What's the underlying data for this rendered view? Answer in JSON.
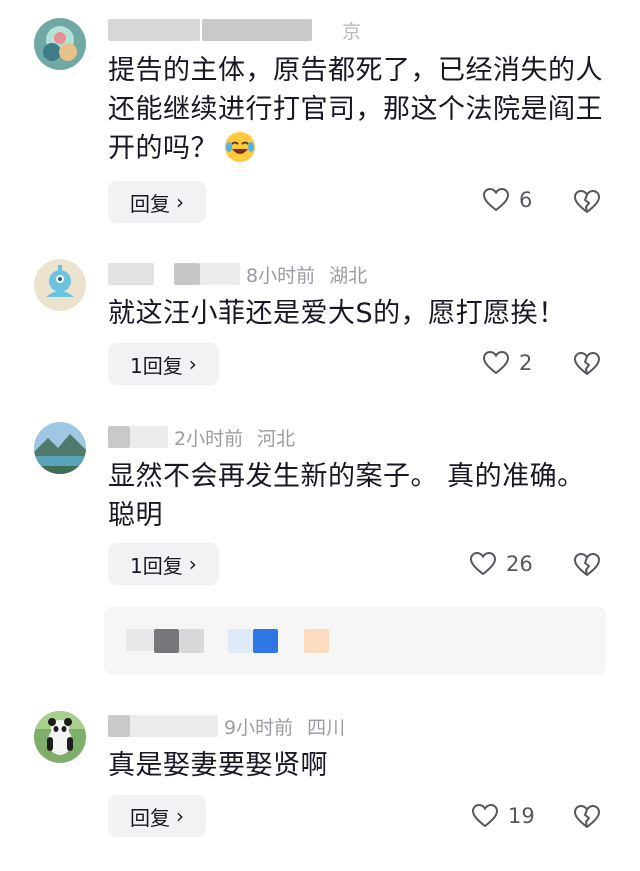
{
  "comments": [
    {
      "location": "京",
      "text": "提告的主体，原告都死了，已经消失的人还能继续进行打官司，那这个法院是阎王开的吗？",
      "reply_label": "回复",
      "likes": "6"
    },
    {
      "time": "8小时前",
      "location": "湖北",
      "text": "就这汪小菲还是爱大S的，愿打愿挨！",
      "reply_label": "1回复",
      "likes": "2"
    },
    {
      "time": "2小时前",
      "location": "河北",
      "text": "显然不会再发生新的案子。 真的准确。聪明",
      "reply_label": "1回复",
      "likes": "26"
    },
    {
      "time": "9小时前",
      "location": "四川",
      "text": "真是娶妻要娶贤啊",
      "reply_label": "回复",
      "likes": "19"
    }
  ],
  "icons": {
    "like": "heart-outline-icon",
    "dislike": "broken-heart-icon",
    "chevron": "chevron-right-icon",
    "emoji": "laughing-crying-emoji"
  },
  "colors": {
    "text": "#161823",
    "meta": "#9a9ca3",
    "reply_bg": "#f2f2f4"
  }
}
